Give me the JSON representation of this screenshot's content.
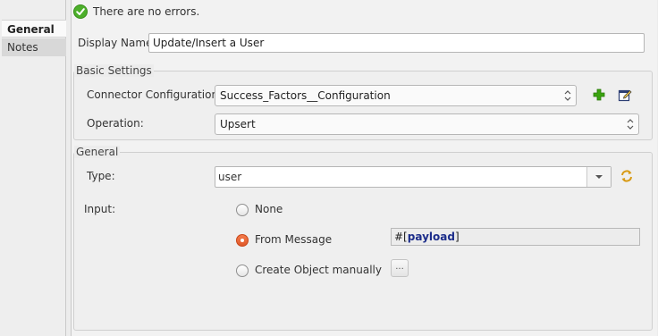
{
  "sidebar": {
    "tabs": [
      {
        "label": "General",
        "active": true
      },
      {
        "label": "Notes",
        "active": false
      }
    ]
  },
  "status": {
    "message": "There are no errors.",
    "icon": "check-circle-icon",
    "color": "#4caf2a"
  },
  "display_name": {
    "label": "Display Name:",
    "value": "Update/Insert a User"
  },
  "basic_settings": {
    "title": "Basic Settings",
    "connector_configuration": {
      "label": "Connector Configuration:",
      "value": "Success_Factors__Configuration",
      "add_icon": "plus-icon",
      "edit_icon": "edit-icon"
    },
    "operation": {
      "label": "Operation:",
      "value": "Upsert"
    }
  },
  "general": {
    "title": "General",
    "type": {
      "label": "Type:",
      "value": "user",
      "refresh_icon": "refresh-icon"
    },
    "input": {
      "label": "Input:",
      "options": [
        {
          "label": "None",
          "selected": false
        },
        {
          "label": "From Message",
          "selected": true
        },
        {
          "label": "Create Object manually",
          "selected": false
        }
      ],
      "expression": {
        "prefix": "#[",
        "keyword": "payload",
        "suffix": "]"
      },
      "ellipsis_label": "..."
    }
  },
  "colors": {
    "accent": "#e8643a",
    "expression_keyword": "#1c2d8a",
    "add_green": "#3aa30f"
  }
}
